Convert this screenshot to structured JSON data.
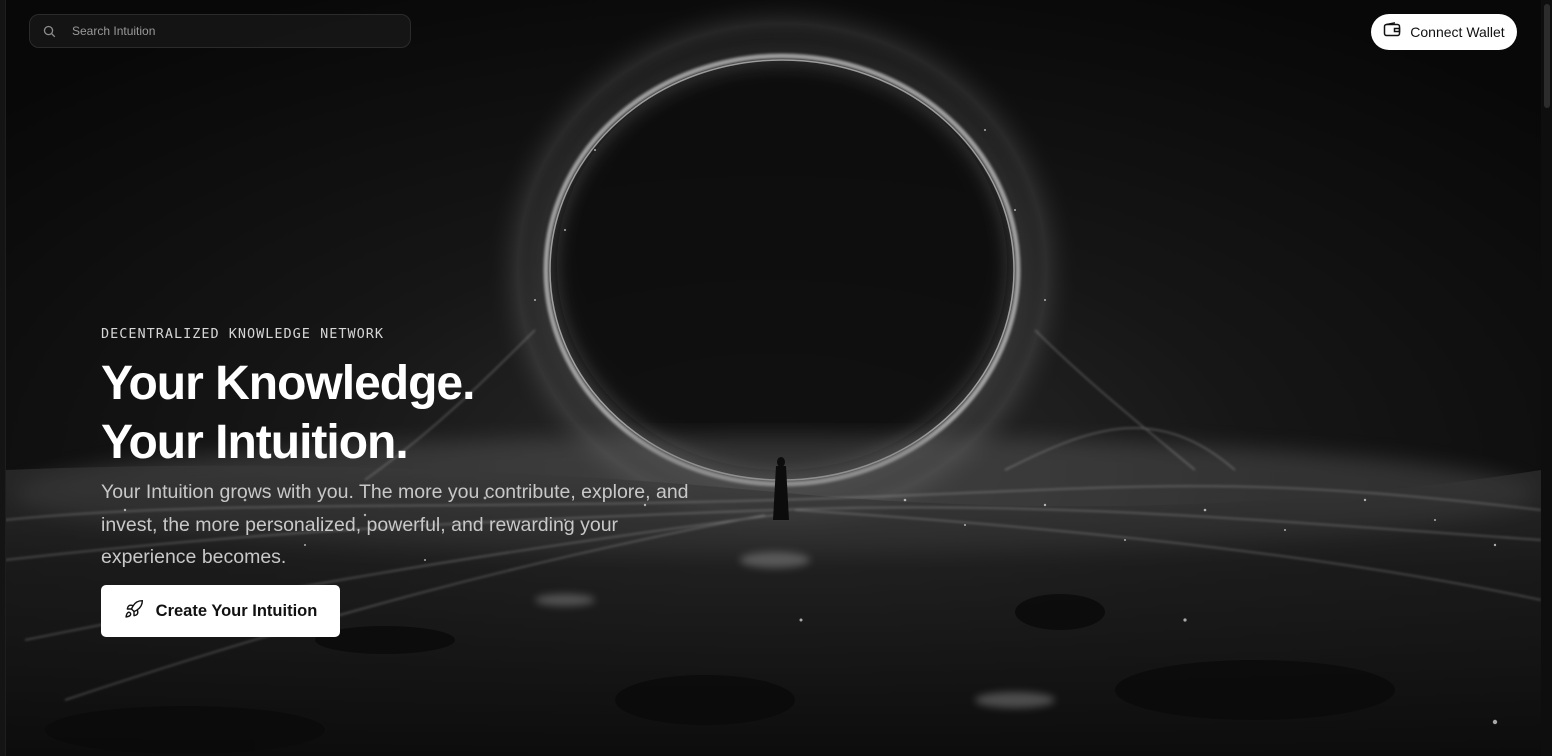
{
  "header": {
    "search": {
      "placeholder": "Search Intuition",
      "value": ""
    },
    "connect_wallet_label": "Connect Wallet"
  },
  "hero": {
    "eyebrow": "DECENTRALIZED KNOWLEDGE NETWORK",
    "headline_line_1": "Your Knowledge.",
    "headline_line_2": "Your Intuition.",
    "description": "Your Intuition grows with you. The more you contribute, explore, and invest, the more personalized, powerful, and rewarding your experience becomes.",
    "cta_label": "Create Your Intuition"
  },
  "icons": {
    "search": "search-icon",
    "wallet": "wallet-icon",
    "cta": "rocket-icon"
  },
  "colors": {
    "background": "#0b0b0b",
    "button_bg": "#ffffff",
    "button_text": "#111111",
    "headline": "#ffffff",
    "body_text": "#c8c8c8"
  }
}
